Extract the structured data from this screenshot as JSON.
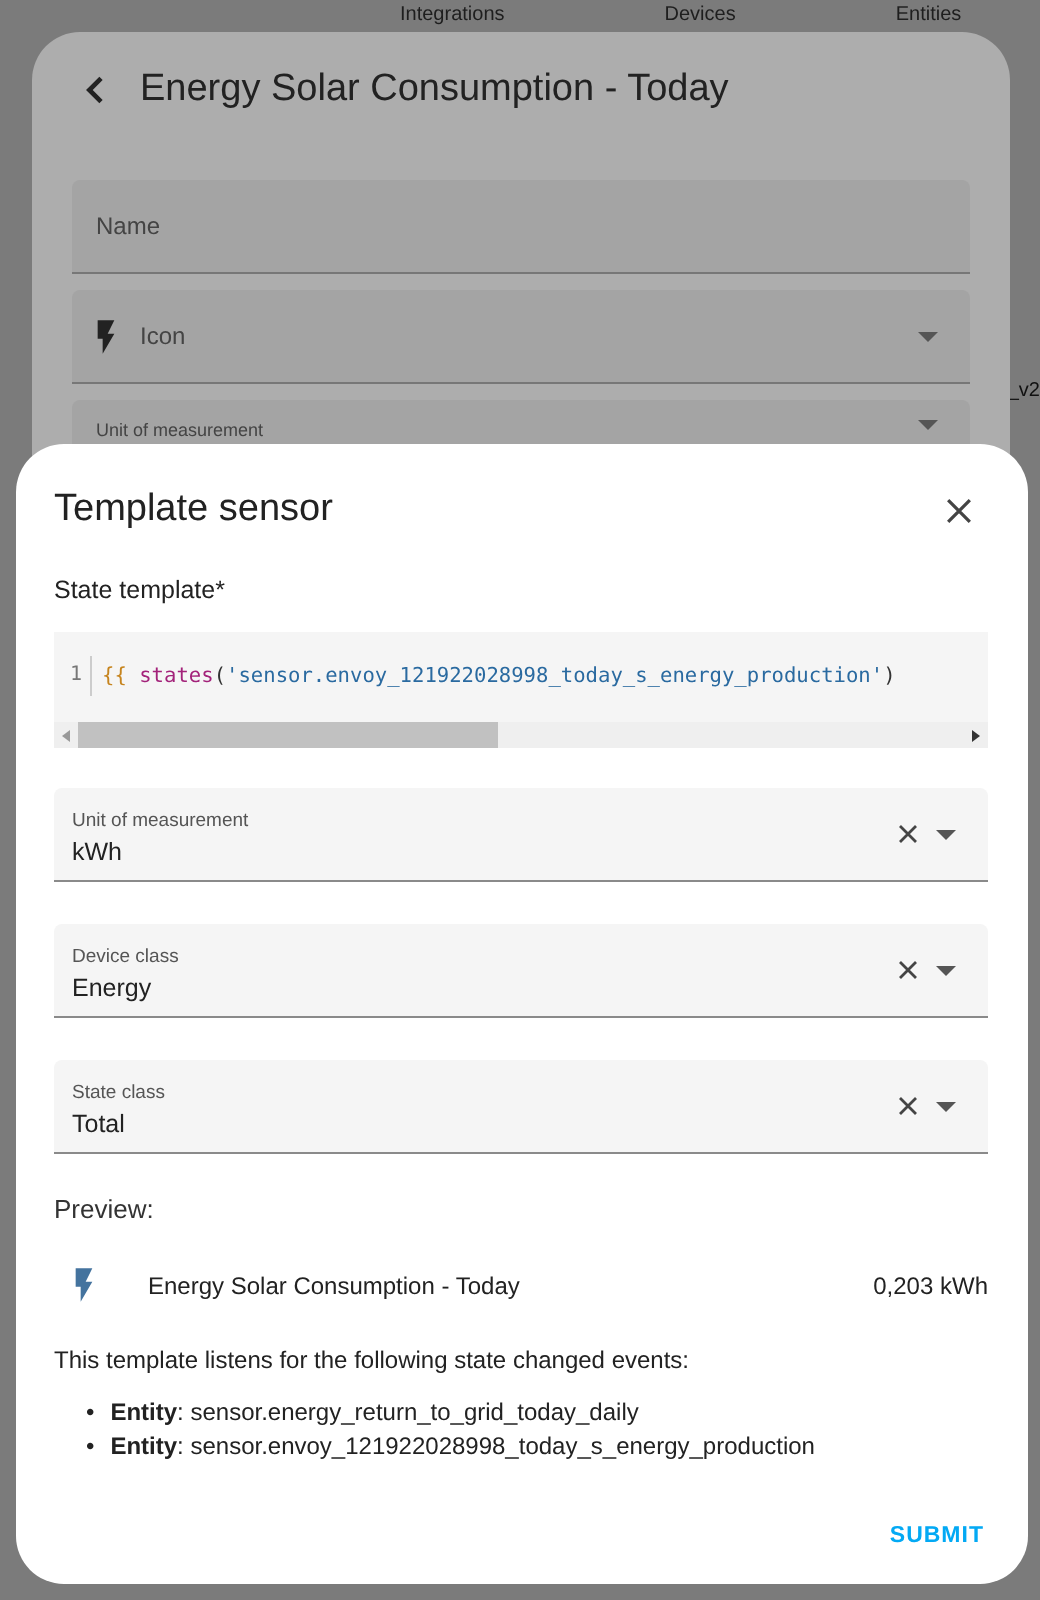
{
  "background_tabs": [
    "Integrations",
    "Devices",
    "Entities"
  ],
  "background_edge_text": "_v2",
  "entity_dialog": {
    "title": "Energy Solar Consumption - Today",
    "fields": [
      {
        "kind": "text",
        "label": "Name"
      },
      {
        "kind": "icon",
        "label": "Icon"
      },
      {
        "kind": "select",
        "label": "Unit of measurement"
      }
    ]
  },
  "template_dialog": {
    "title": "Template sensor",
    "state_template_label": "State template*",
    "code": {
      "line_number": "1",
      "tokens": [
        {
          "kind": "brace",
          "text": "{{ "
        },
        {
          "kind": "func",
          "text": "states"
        },
        {
          "kind": "plain",
          "text": "("
        },
        {
          "kind": "string",
          "text": "'sensor.envoy_121922028998_today_s_energy_production'"
        },
        {
          "kind": "plain",
          "text": ")"
        }
      ]
    },
    "fields": [
      {
        "label": "Unit of measurement",
        "value": "kWh"
      },
      {
        "label": "Device class",
        "value": "Energy"
      },
      {
        "label": "State class",
        "value": "Total"
      }
    ],
    "preview_label": "Preview:",
    "preview": {
      "name": "Energy Solar Consumption - Today",
      "state": "0,203 kWh"
    },
    "listens_text": "This template listens for the following state changed events:",
    "entities": [
      {
        "bullet": "•",
        "text": "**Entity**: sensor.energy_return_to_grid_today_daily"
      },
      {
        "bullet": "•",
        "text": "**Entity**: sensor.envoy_121922028998_today_s_energy_production"
      }
    ],
    "submit": "SUBMIT"
  }
}
